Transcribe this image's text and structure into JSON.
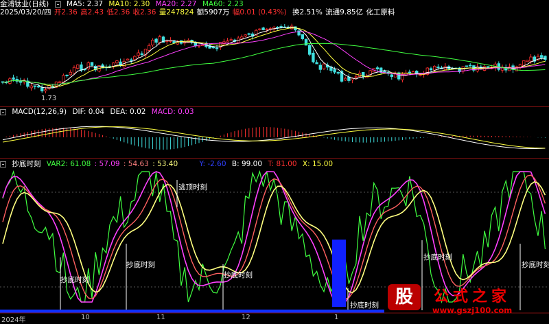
{
  "colors": {
    "up": "#ff3030",
    "down": "#40e0e0",
    "ma5": "#ffffff",
    "ma10": "#ffff40",
    "ma20": "#ff40ff",
    "ma60": "#40ff40"
  },
  "header": {
    "stock_title": "金浦钛业(日线)",
    "ma5": "MA5: 2.37",
    "ma10": "MA10: 2.30",
    "ma20": "MA20: 2.27",
    "ma60": "MA60: 2.23",
    "date": "2025/03/20/四",
    "open": "开2.36",
    "high": "高2.43",
    "low": "低2.36",
    "close": "收2.36",
    "volume": "量247824",
    "amount": "额5907万",
    "change": "幅0.01 (0.43%)",
    "turnover": "换2.51%",
    "float": "流通9.85亿",
    "sector": "化工原料",
    "low_marker": "1.73"
  },
  "macd": {
    "name": "MACD(12,26,9)",
    "dif": "DIF: 0.04",
    "dea": "DEA: 0.02",
    "macd": "MACD: 0.03"
  },
  "indicator": {
    "name": "抄底时刻",
    "var2": "VAR2: 61.08",
    "v2": ": 57.09",
    "v3": ": 54.63",
    "v4": ": 53.40",
    "y": "Y: -2.60",
    "b": "B: 99.00",
    "t": "T: 81.00",
    "x": "X: 15.00"
  },
  "annotations": {
    "bottom": "抄底时刻",
    "top": "逃顶时刻"
  },
  "xaxis": [
    "2024年",
    "10",
    "11",
    "12",
    "1"
  ],
  "watermark": {
    "logo": "股",
    "title": "公式之家",
    "url": "www.gszj100.com"
  }
}
